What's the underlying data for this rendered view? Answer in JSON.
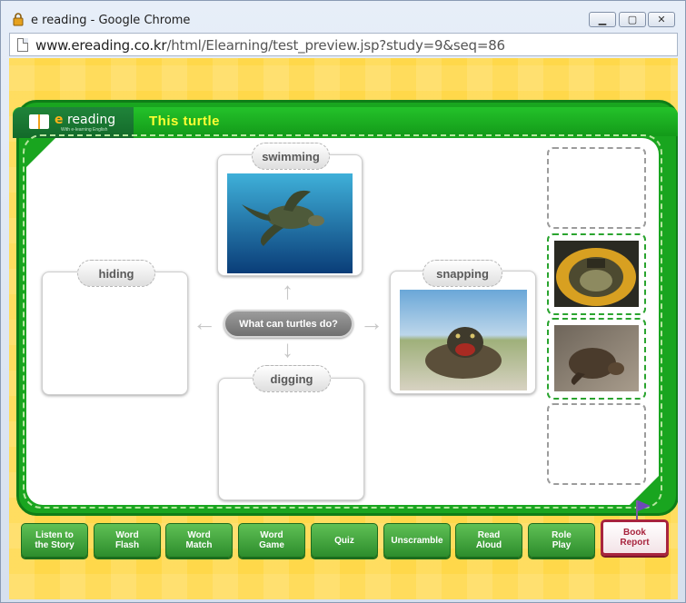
{
  "window": {
    "title": "e reading - Google Chrome",
    "controls": {
      "minimize": "▁",
      "maximize": "▢",
      "close": "✕"
    }
  },
  "address_bar": {
    "domain": "www.ereading.co.kr",
    "path": "/html/Elearning/test_preview.jsp?study=9&seq=86"
  },
  "app": {
    "logo_prefix": "e",
    "logo_word": " reading",
    "logo_tagline": "With e-learning English",
    "page_title": "This  turtle"
  },
  "mindmap": {
    "center_question": "What can turtles do?",
    "cards": {
      "top": {
        "label": "swimming",
        "image": "sea-turtle-swimming-photo"
      },
      "left": {
        "label": "hiding",
        "image": null
      },
      "right": {
        "label": "snapping",
        "image": "snapping-turtle-photo"
      },
      "bottom": {
        "label": "digging",
        "image": null
      }
    },
    "answer_slots": [
      {
        "state": "empty",
        "image": null
      },
      {
        "state": "filled",
        "image": "turtle-hiding-in-shell-photo"
      },
      {
        "state": "filled",
        "image": "turtle-digging-sand-photo"
      },
      {
        "state": "empty",
        "image": null
      }
    ]
  },
  "bottom_nav": {
    "buttons": [
      "Listen to\nthe Story",
      "Word\nFlash",
      "Word\nMatch",
      "Word\nGame",
      "Quiz",
      "Unscramble",
      "Read\nAloud",
      "Role\nPlay",
      "Book\nReport"
    ],
    "active": "Book\nReport"
  },
  "colors": {
    "background": "#ffd84a",
    "board_green": "#19a51f",
    "title_yellow": "#ffff33",
    "nav_green": "#3fa33c",
    "book_report_red": "#a8243e"
  }
}
